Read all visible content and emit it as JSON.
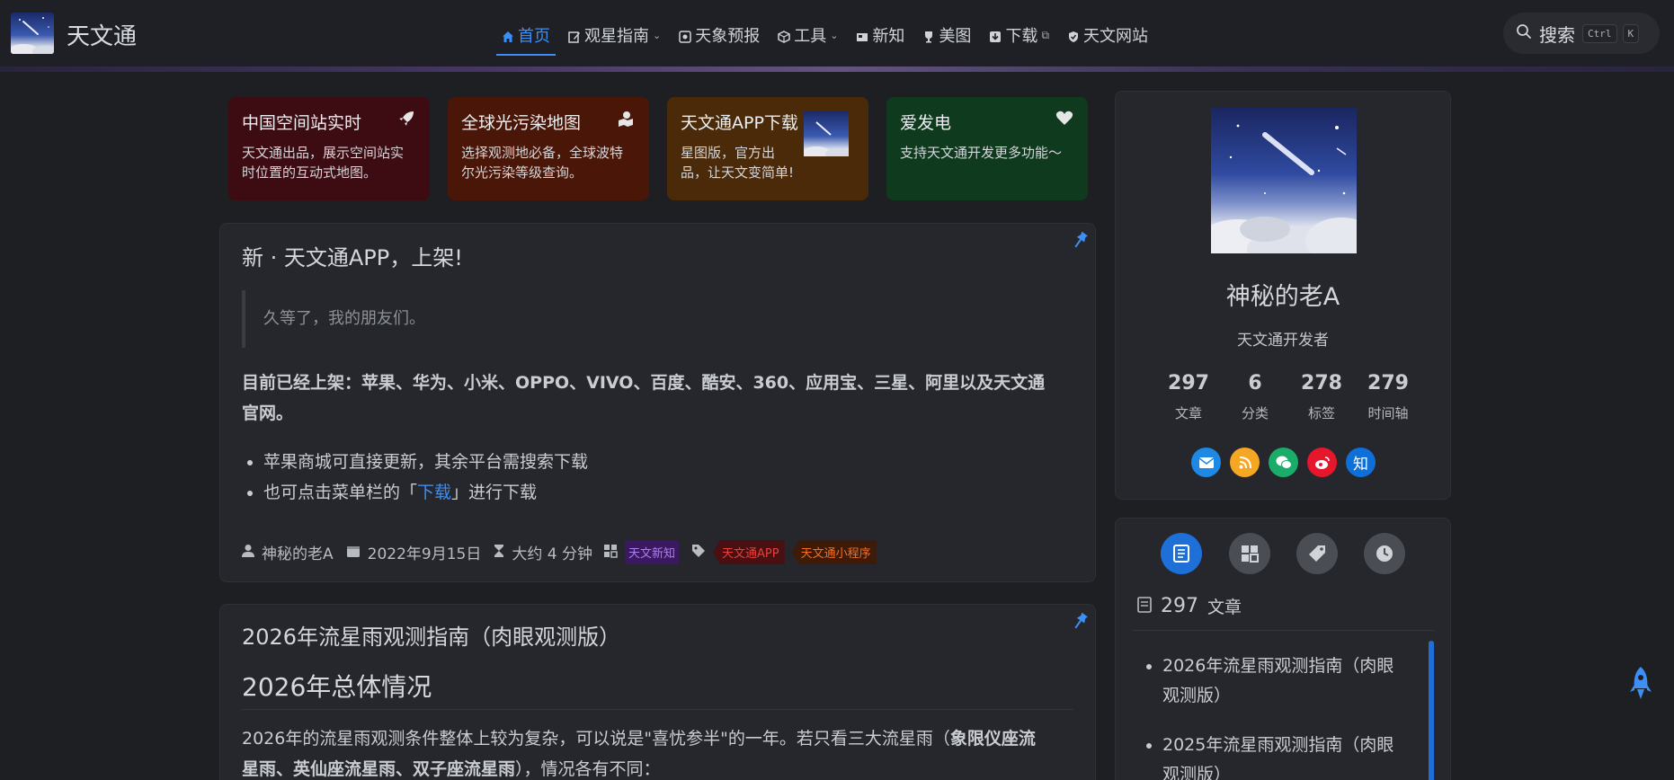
{
  "header": {
    "brand": "天文通",
    "nav": [
      {
        "label": "首页",
        "active": true,
        "icon": "home-icon"
      },
      {
        "label": "观星指南",
        "caret": true,
        "icon": "edit-icon"
      },
      {
        "label": "天象预报",
        "icon": "forecast-icon"
      },
      {
        "label": "工具",
        "caret": true,
        "icon": "cube-icon"
      },
      {
        "label": "新知",
        "icon": "card-icon"
      },
      {
        "label": "美图",
        "icon": "trophy-icon"
      },
      {
        "label": "下载",
        "external": true,
        "icon": "download-icon"
      },
      {
        "label": "天文网站",
        "icon": "shield-icon"
      }
    ],
    "search_label": "搜索",
    "kbd1": "Ctrl",
    "kbd2": "K"
  },
  "features": [
    {
      "title": "中国空间站实时",
      "desc": "天文通出品，展示空间站实时位置的互动式地图。",
      "color": "#3d0c12"
    },
    {
      "title": "全球光污染地图",
      "desc": "选择观测地必备，全球波特尔光污染等级查询。",
      "color": "#4a1608"
    },
    {
      "title": "天文通APP下载",
      "desc": "星图版，官方出品，让天文变简单!",
      "color": "#4a2a08"
    },
    {
      "title": "爱发电",
      "desc": "支持天文通开发更多功能～",
      "color": "#0f3a1e"
    }
  ],
  "post1": {
    "title": "新 · 天文通APP，上架!",
    "quote": "久等了，我的朋友们。",
    "para_line1": "目前已经上架：苹果、华为、小米、OPPO、VIVO、百度、酷安、360、应用宝、三星、阿里以及天文通",
    "para_line2": "官网。",
    "bullet1": "苹果商城可直接更新，其余平台需搜索下载",
    "bullet2_pre": "也可点击菜单栏的「",
    "bullet2_link": "下载",
    "bullet2_post": "」进行下载",
    "author": "神秘的老A",
    "date": "2022年9月15日",
    "read_time": "大约 4 分钟",
    "category": "天文新知",
    "tag1": "天文通APP",
    "tag2": "天文通小程序"
  },
  "post2": {
    "title": "2026年流星雨观测指南（肉眼观测版）",
    "h2": "2026年总体情况",
    "line1_pre": "2026年的流星雨观测条件整体上较为复杂，可以说是\"喜忧参半\"的一年。若只看三大流星雨（",
    "line1_bold": "象限仪座流",
    "line2_bold": "星雨、英仙座流星雨、双子座流星雨",
    "line2_post": "），情况各有不同："
  },
  "profile": {
    "name": "神秘的老A",
    "subtitle": "天文通开发者",
    "stats": [
      {
        "num": "297",
        "label": "文章"
      },
      {
        "num": "6",
        "label": "分类"
      },
      {
        "num": "278",
        "label": "标签"
      },
      {
        "num": "279",
        "label": "时间轴"
      }
    ],
    "zhihu": "知"
  },
  "articles_panel": {
    "count": "297",
    "label": "文章",
    "items": [
      "2026年流星雨观测指南（肉眼观测版）",
      "2025年流星雨观测指南（肉眼观测版）"
    ]
  },
  "colors": {
    "accent": "#3d8ef5",
    "mail": "#1e88e5",
    "rss": "#f5a623",
    "wechat": "#1aad6a",
    "weibo": "#e6162d",
    "zhihu": "#0f6fd9"
  }
}
